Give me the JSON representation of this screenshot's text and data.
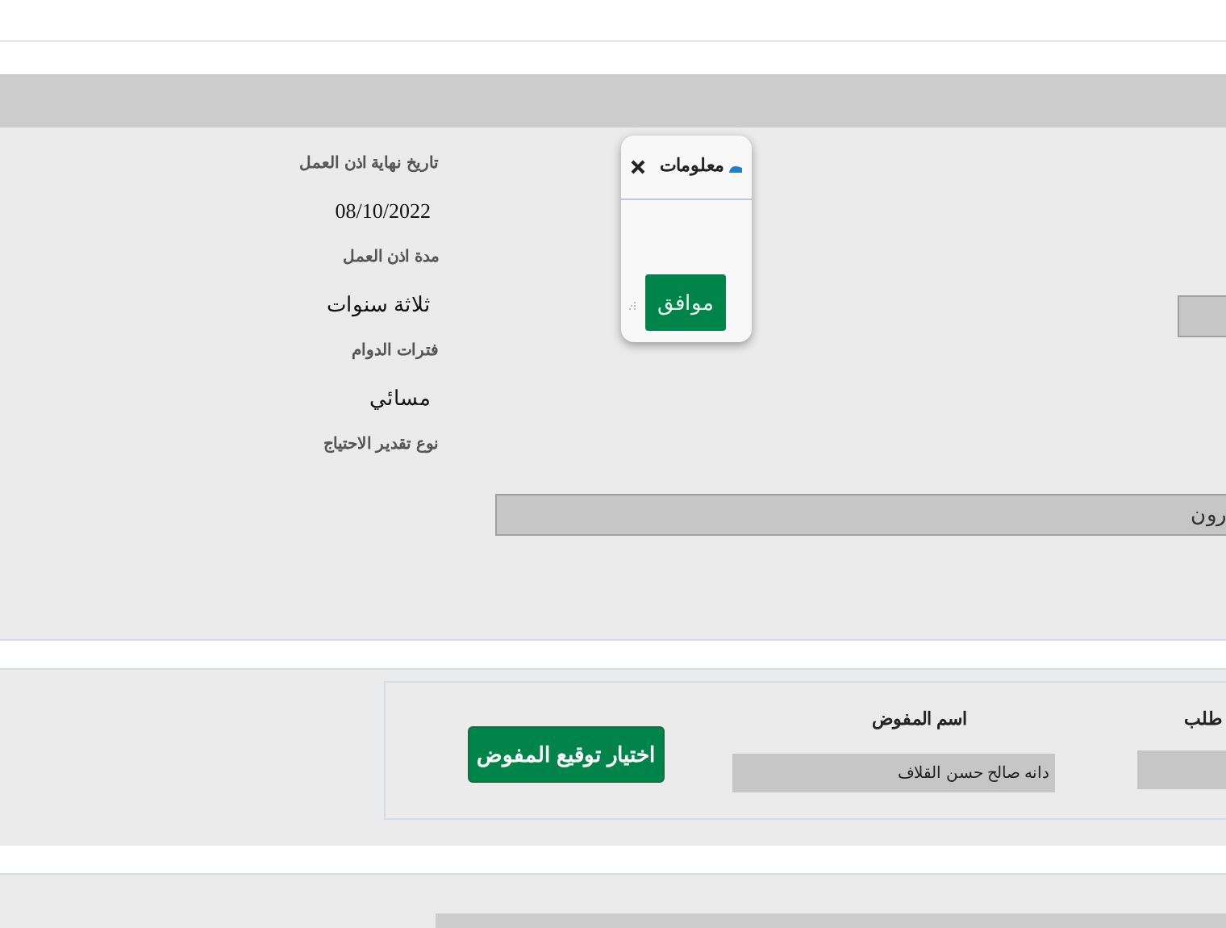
{
  "details": [
    {
      "label": "تاريخ نهاية اذن العمل",
      "value": "08/10/2022",
      "kind": "date"
    },
    {
      "label": "مدة اذن العمل",
      "value": "ثلاثة سنوات",
      "kind": "text"
    },
    {
      "label": "فترات الدوام",
      "value": "مسائي",
      "kind": "text"
    },
    {
      "label": "نوع تقدير الاحتياج"
    }
  ],
  "wide_field": {
    "value": "رون"
  },
  "request": {
    "label": "طلب"
  },
  "delegate": {
    "label": "اسم المفوض",
    "value": "دانه صالح حسن القلاف"
  },
  "select_button": "اختيار توقيع المفوض",
  "dialog": {
    "title": "معلومات",
    "ok_button": "موافق"
  }
}
